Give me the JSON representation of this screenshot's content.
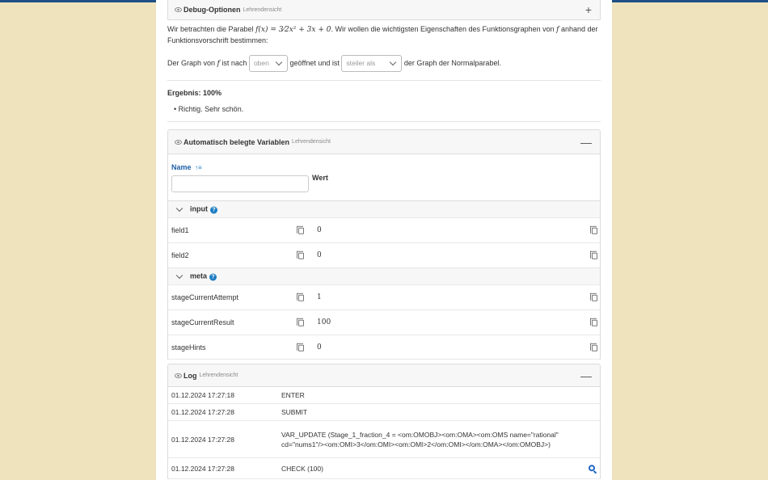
{
  "debug_panel": {
    "title": "Debug-Optionen",
    "subtitle": "Lehrendensicht",
    "toggle": "+"
  },
  "task": {
    "intro_a": "Wir betrachten die Parabel",
    "formula": "f(x) = 3⁄2x² + 3x + 0",
    "intro_b": ". Wir wollen die wichtigsten Eigenschaften des Funktionsgraphen von",
    "fvar": "f",
    "intro_c": "anhand der",
    "intro_line2": "Funktionsvorschrift bestimmen:",
    "s_a": "Der Graph von",
    "s_f": "f",
    "s_b": "ist nach",
    "select1": "oben",
    "s_c": "geöffnet und ist",
    "select2": "steiler als",
    "s_d": "der Graph der Normalparabel."
  },
  "result": {
    "label": "Ergebnis: 100%",
    "feedback": "Richtig. Sehr schön."
  },
  "vars_panel": {
    "title": "Automatisch belegte Variablen",
    "subtitle": "Lehrendensicht",
    "toggle": "—",
    "col_name": "Name",
    "sort_icon": "↑≡",
    "col_value": "Wert",
    "filter_placeholder": ""
  },
  "groups": {
    "input": {
      "label": "input",
      "help": "?",
      "rows": [
        {
          "name": "field1",
          "value": "0"
        },
        {
          "name": "field2",
          "value": "0"
        }
      ]
    },
    "meta": {
      "label": "meta",
      "help": "?",
      "rows": [
        {
          "name": "stageCurrentAttempt",
          "value": "1"
        },
        {
          "name": "stageCurrentResult",
          "value": "100"
        },
        {
          "name": "stageHints",
          "value": "0"
        }
      ]
    }
  },
  "log_panel": {
    "title": "Log",
    "subtitle": "Lehrendensicht",
    "toggle": "—",
    "entries": [
      {
        "time": "01.12.2024 17:27:18",
        "message": "ENTER"
      },
      {
        "time": "01.12.2024 17:27:28",
        "message": "SUBMIT"
      },
      {
        "time": "01.12.2024 17:27:28",
        "message": "VAR_UPDATE (Stage_1_fraction_4 = <om:OMOBJ><om:OMA><om:OMS name=\"rational\" cd=\"nums1\"/><om:OMI>3</om:OMI><om:OMI>2</om:OMI></om:OMA></om:OMOBJ>)"
      },
      {
        "time": "01.12.2024 17:27:28",
        "message": "CHECK (100)"
      }
    ]
  },
  "colors": {
    "accent": "#1e7fc4",
    "background": "#efe3bd",
    "topbar": "#1f4f86"
  },
  "icons": [
    "eye-icon",
    "plus-icon",
    "minus-icon",
    "chevron-down-icon",
    "copy-icon",
    "help-icon",
    "sort-icon",
    "zoom-icon"
  ]
}
